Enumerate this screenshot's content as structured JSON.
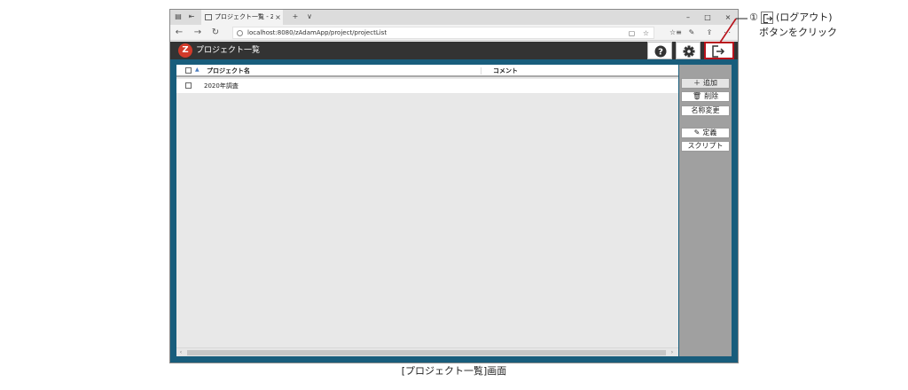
{
  "browser": {
    "tab_title": "プロジェクト一覧 - Z-Adar",
    "tab_close": "×",
    "new_tab": "+",
    "tab_menu": "∨",
    "win_minimize": "–",
    "win_maximize": "□",
    "win_close": "×",
    "url": "localhost:8080/zAdamApp/project/projectList",
    "nav_back": "←",
    "nav_forward": "→",
    "nav_refresh": "↻",
    "reading_view": "▢",
    "favorite": "☆",
    "favorites_hub": "☆≡",
    "notes": "✎",
    "share": "⇪",
    "more": "⋯"
  },
  "app": {
    "title": "プロジェクト一覧",
    "logo_glyph": "Z"
  },
  "grid": {
    "columns": [
      "プロジェクト名",
      "コメント"
    ],
    "rows": [
      {
        "name": "2020年調査",
        "comment": ""
      }
    ]
  },
  "side_buttons": [
    {
      "label": "追加",
      "icon_glyph": "＋"
    },
    {
      "label": "削除",
      "icon_glyph": "🗑"
    },
    {
      "label": "名称変更",
      "icon_glyph": ""
    },
    {
      "label": "定義",
      "icon_glyph": "✎"
    },
    {
      "label": "スクリプト",
      "icon_glyph": ""
    }
  ],
  "annotation": {
    "number": "①",
    "line1": "(ログアウト)",
    "line2": "ボタンをクリック"
  },
  "caption": "[プロジェクト一覧]画面",
  "colors": {
    "header_bg": "#333333",
    "frame_blue": "#185d7c",
    "highlight_red": "#b8121b",
    "logo_red": "#d23a2a",
    "side_panel_gray": "#a0a0a0"
  }
}
